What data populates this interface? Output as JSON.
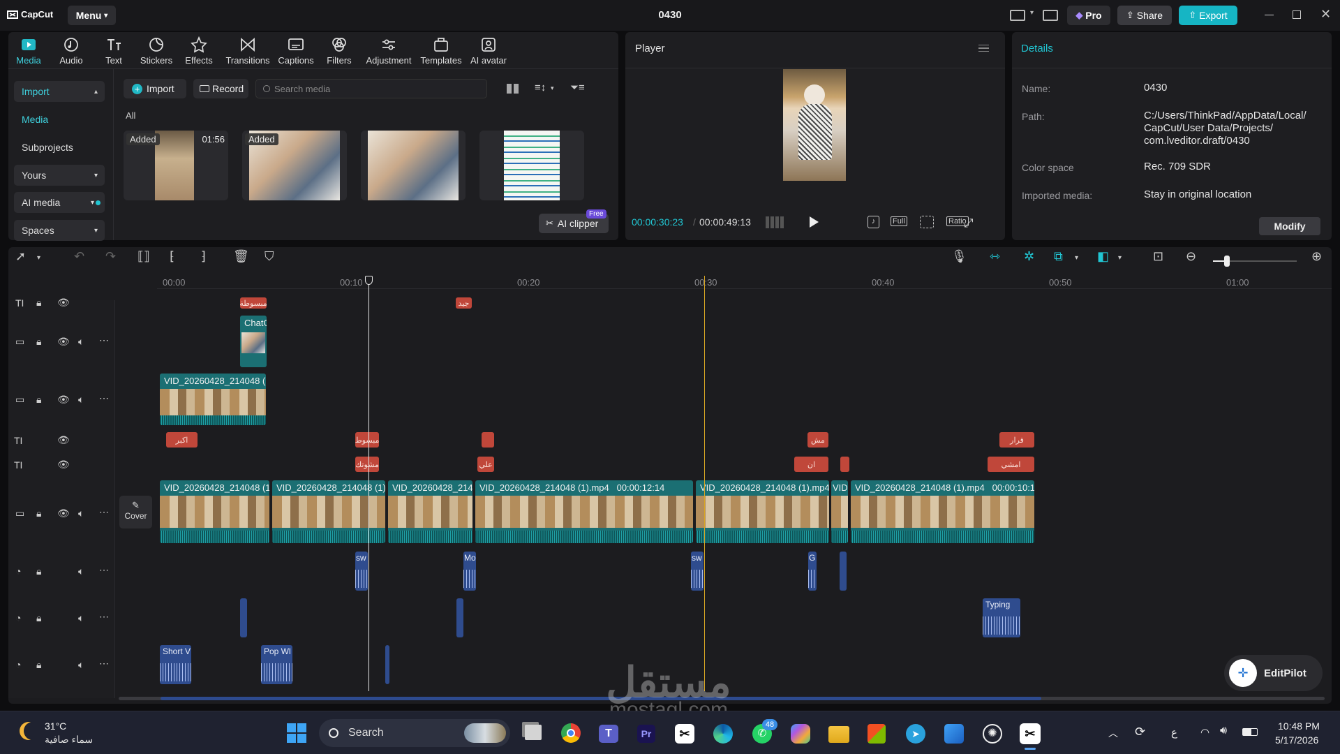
{
  "app": {
    "name": "CapCut",
    "menu": "Menu",
    "project_title": "0430"
  },
  "titlebar": {
    "pro": "Pro",
    "share": "Share",
    "export": "Export"
  },
  "toolbar": [
    "Media",
    "Audio",
    "Text",
    "Stickers",
    "Effects",
    "Transitions",
    "Captions",
    "Filters",
    "Adjustment",
    "Templates",
    "AI avatar"
  ],
  "media_sidebar": {
    "import": "Import",
    "media": "Media",
    "subprojects": "Subprojects",
    "yours": "Yours",
    "ai_media": "AI media",
    "spaces": "Spaces"
  },
  "media_toolbar": {
    "import": "Import",
    "record": "Record",
    "search_placeholder": "Search media",
    "filter_all": "All"
  },
  "media_items": [
    {
      "badge": "Added",
      "duration": "01:56"
    },
    {
      "badge": "Added",
      "duration": ""
    },
    {
      "badge": "",
      "duration": ""
    },
    {
      "badge": "",
      "duration": ""
    }
  ],
  "ai_clipper": {
    "label": "AI clipper",
    "badge": "Free"
  },
  "player": {
    "title": "Player",
    "current_time": "00:00:30:23",
    "total_time": "00:00:49:13",
    "full": "Full",
    "ratio": "Ratio"
  },
  "details": {
    "title": "Details",
    "name_label": "Name:",
    "name_value": "0430",
    "path_label": "Path:",
    "path_value_1": "C:/Users/ThinkPad/AppData/Local/",
    "path_value_2": "CapCut/User Data/Projects/",
    "path_value_3": "com.lveditor.draft/0430",
    "color_label": "Color space",
    "color_value": "Rec. 709 SDR",
    "imported_label": "Imported media:",
    "imported_value": "Stay in original location",
    "modify": "Modify"
  },
  "ruler": [
    "00:00",
    "00:10",
    "00:20",
    "00:30",
    "00:40",
    "00:50",
    "01:00"
  ],
  "timeline": {
    "cover": "Cover",
    "overlay_clip_label": "ChatG",
    "video2_label": "VID_20260428_214048 (1",
    "main_clips": [
      {
        "label": "VID_20260428_214048 (1"
      },
      {
        "label": "VID_20260428_214048 (1)."
      },
      {
        "label": "VID_20260428_214"
      },
      {
        "label": "VID_20260428_214048 (1).mp4   00:00:12:14"
      },
      {
        "label": "VID_20260428_214048 (1).mp4"
      },
      {
        "label": "VID"
      },
      {
        "label": "VID_20260428_214048 (1).mp4   00:00:10:1"
      }
    ],
    "text_row1": [
      "اكبر",
      "مبسوط",
      "",
      "مش",
      "قرار"
    ],
    "text_row2": [
      "مشوتك",
      "علي",
      "ان",
      "",
      "امشي"
    ],
    "text_top": [
      "مبسوطة",
      "جيد"
    ],
    "audio_row1": [
      "sw",
      "Mo",
      "sw",
      "G",
      ""
    ],
    "audio_row2": [
      "",
      "",
      "Typing"
    ],
    "audio_row3": [
      "Short V",
      "Pop Wl",
      ""
    ]
  },
  "editpilot": "EditPilot",
  "watermark": {
    "arabic": "مستقل",
    "latin": "mostaql.com"
  },
  "taskbar": {
    "weather_temp": "31°C",
    "weather_text": "سماء صافية",
    "search": "Search",
    "whatsapp_badge": "48",
    "lang": "ع",
    "time": "10:48 PM",
    "date": "5/17/2026"
  }
}
